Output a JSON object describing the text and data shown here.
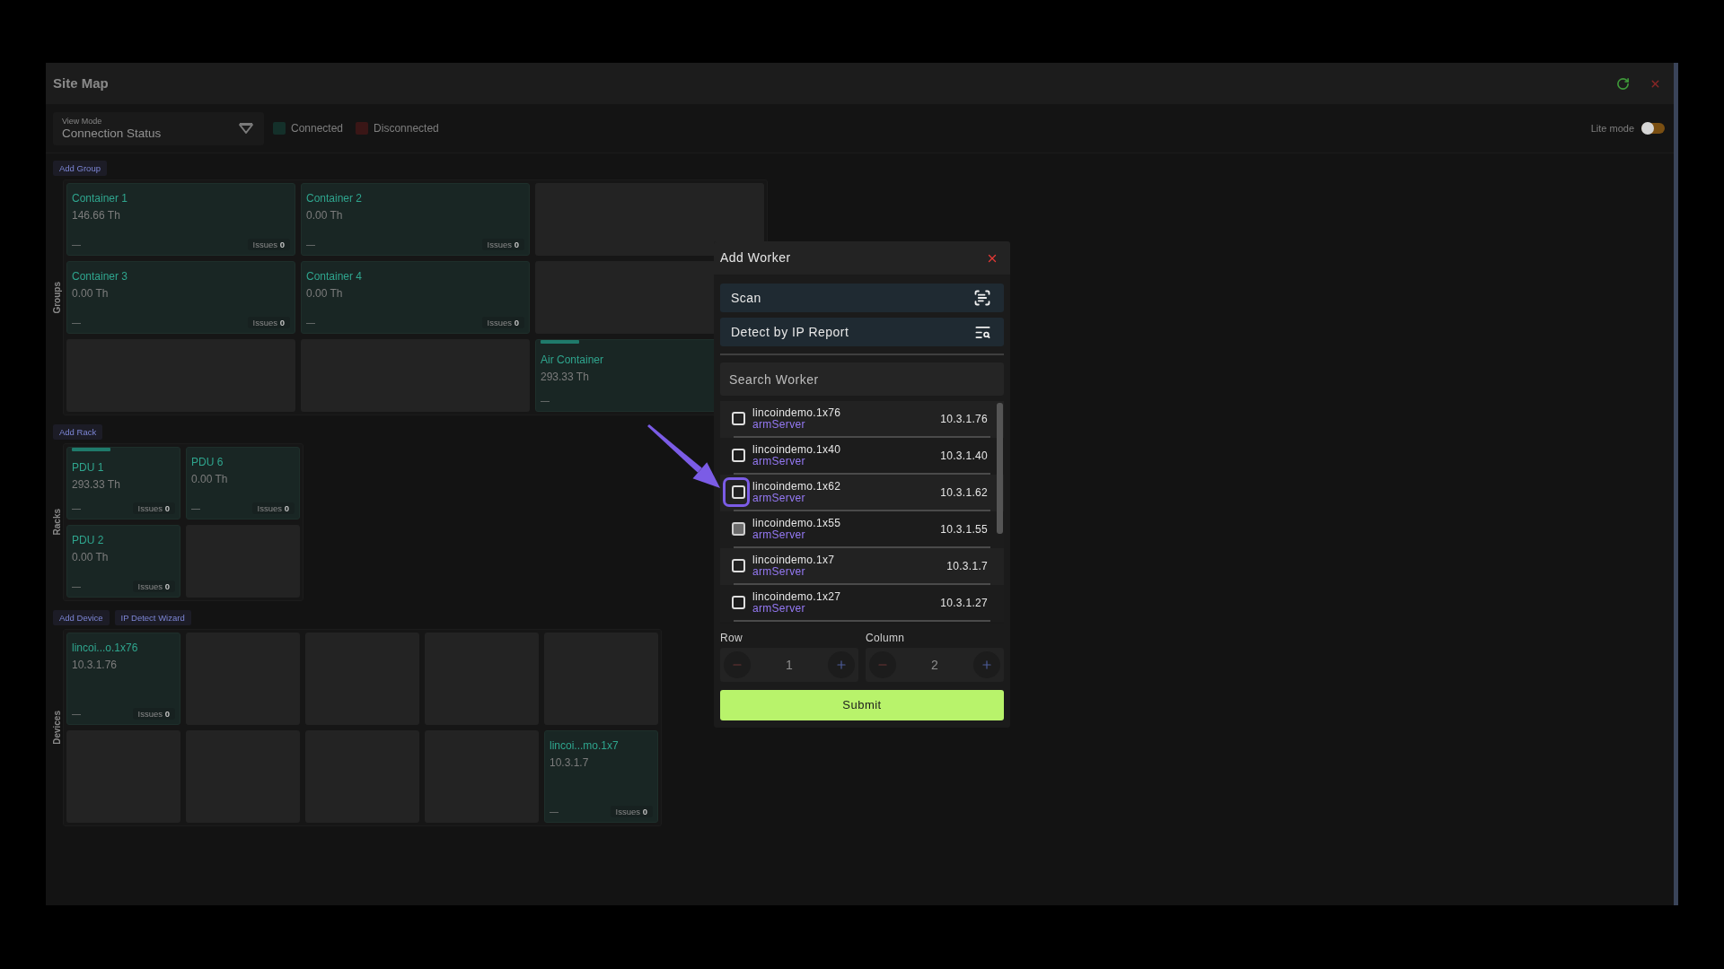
{
  "window": {
    "title": "Site Map"
  },
  "toolbar": {
    "view_mode": {
      "label": "View Mode",
      "value": "Connection Status"
    },
    "legend": [
      {
        "label": "Connected",
        "color": "#14302a"
      },
      {
        "label": "Disconnected",
        "color": "#3a1616"
      }
    ],
    "lite_mode": {
      "label": "Lite mode",
      "on": false
    }
  },
  "groups": {
    "label": "Groups",
    "actions": [
      "Add Group"
    ],
    "slots": [
      {
        "kind": "node",
        "name": "Container 1",
        "value": "146.66 Th",
        "status": "—",
        "issues": "Issues **0**",
        "connected": true,
        "selected": false
      },
      {
        "kind": "node",
        "name": "Container 2",
        "value": "0.00 Th",
        "status": "—",
        "issues": "Issues **0**",
        "connected": true,
        "selected": false
      },
      {
        "kind": "empty"
      },
      {
        "kind": "node",
        "name": "Container 3",
        "value": "0.00 Th",
        "status": "—",
        "issues": "Issues **0**",
        "connected": true,
        "selected": false
      },
      {
        "kind": "node",
        "name": "Container 4",
        "value": "0.00 Th",
        "status": "—",
        "issues": "Issues **0**",
        "connected": true,
        "selected": false
      },
      {
        "kind": "empty"
      },
      {
        "kind": "empty"
      },
      {
        "kind": "empty"
      },
      {
        "kind": "node",
        "name": "Air Container",
        "value": "293.33 Th",
        "status": "—",
        "connected": true,
        "selected": true
      }
    ]
  },
  "racks": {
    "label": "Racks",
    "actions": [
      "Add Rack"
    ],
    "slots": [
      {
        "kind": "node",
        "name": "PDU 1",
        "value": "293.33 Th",
        "status": "—",
        "issues": "Issues **0**",
        "connected": true,
        "selected": true
      },
      {
        "kind": "node",
        "name": "PDU 6",
        "value": "0.00 Th",
        "status": "—",
        "issues": "Issues **0**",
        "connected": true,
        "selected": false
      },
      {
        "kind": "node",
        "name": "PDU 2",
        "value": "0.00 Th",
        "status": "—",
        "issues": "Issues **0**",
        "connected": true,
        "selected": false
      },
      {
        "kind": "empty"
      }
    ]
  },
  "devices": {
    "label": "Devices",
    "actions": [
      "Add Device",
      "IP Detect Wizard"
    ],
    "slots": [
      {
        "kind": "node",
        "name": "lincoi...o.1x76",
        "value": "10.3.1.76",
        "status": "—",
        "issues": "Issues **0**",
        "connected": true,
        "selected": false
      },
      {
        "kind": "empty"
      },
      {
        "kind": "empty"
      },
      {
        "kind": "empty"
      },
      {
        "kind": "empty"
      },
      {
        "kind": "empty"
      },
      {
        "kind": "empty"
      },
      {
        "kind": "empty"
      },
      {
        "kind": "empty"
      },
      {
        "kind": "node",
        "name": "lincoi...mo.1x7",
        "value": "10.3.1.7",
        "status": "—",
        "issues": "Issues **0**",
        "connected": true,
        "selected": false
      }
    ]
  },
  "dialog": {
    "title": "Add Worker",
    "actions": [
      {
        "kind": "scan",
        "label": "Scan"
      },
      {
        "kind": "detect",
        "label": "Detect by IP Report"
      }
    ],
    "search": {
      "placeholder": "Search Worker"
    },
    "workers": [
      {
        "name": "lincoindemo.1x76",
        "type": "armServer",
        "ip": "10.3.1.76",
        "checked": false,
        "disabled": false,
        "highlighted": false
      },
      {
        "name": "lincoindemo.1x40",
        "type": "armServer",
        "ip": "10.3.1.40",
        "checked": false,
        "disabled": false,
        "highlighted": false
      },
      {
        "name": "lincoindemo.1x62",
        "type": "armServer",
        "ip": "10.3.1.62",
        "checked": false,
        "disabled": false,
        "highlighted": true
      },
      {
        "name": "lincoindemo.1x55",
        "type": "armServer",
        "ip": "10.3.1.55",
        "checked": false,
        "disabled": true,
        "highlighted": false
      },
      {
        "name": "lincoindemo.1x7",
        "type": "armServer",
        "ip": "10.3.1.7",
        "checked": false,
        "disabled": false,
        "highlighted": false
      },
      {
        "name": "lincoindemo.1x27",
        "type": "armServer",
        "ip": "10.3.1.27",
        "checked": false,
        "disabled": false,
        "highlighted": false
      }
    ],
    "row": {
      "label": "Row",
      "value": "1"
    },
    "column": {
      "label": "Column",
      "value": "2"
    },
    "submit": "Submit"
  }
}
